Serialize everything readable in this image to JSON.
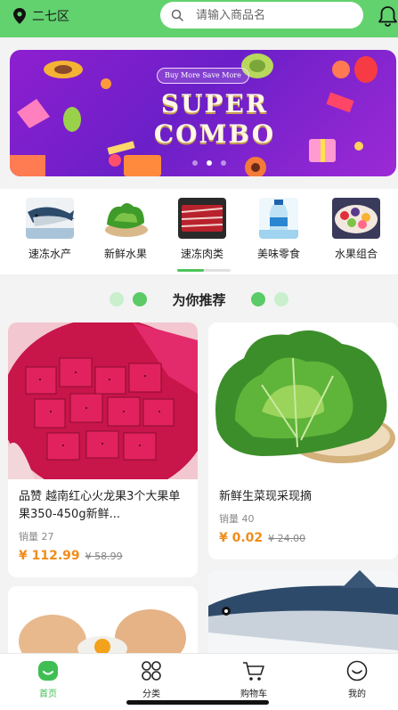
{
  "header": {
    "location": "二七区",
    "search_placeholder": "请输入商品名"
  },
  "banner": {
    "tag": "Buy More Save More",
    "title_line1": "SUPER",
    "title_line2": "COMBO",
    "page_count": 3,
    "active_page": 2
  },
  "categories": [
    {
      "label": "速冻水产",
      "icon": "fish-image"
    },
    {
      "label": "新鲜水果",
      "icon": "lettuce-image"
    },
    {
      "label": "速冻肉类",
      "icon": "meat-image"
    },
    {
      "label": "美味零食",
      "icon": "water-bottle-image"
    },
    {
      "label": "水果组合",
      "icon": "fruit-combo-image"
    }
  ],
  "section": {
    "title": "为你推荐"
  },
  "products": [
    {
      "title": "品赞 越南红心火龙果3个大果单果350-450g新鲜...",
      "sales": "销量 27",
      "price": "¥ 112.99",
      "old_price": "¥ 58.99",
      "image": "dragon-fruit-image"
    },
    {
      "title": "新鲜生菜现采现摘",
      "sales": "销量 40",
      "price": "¥ 0.02",
      "old_price": "¥ 24.00",
      "image": "lettuce-image"
    },
    {
      "image": "eggs-image"
    },
    {
      "image": "fish-image"
    }
  ],
  "tabbar": {
    "items": [
      {
        "label": "首页",
        "icon": "home-icon",
        "active": true
      },
      {
        "label": "分类",
        "icon": "category-icon",
        "active": false
      },
      {
        "label": "购物车",
        "icon": "cart-icon",
        "active": false
      },
      {
        "label": "我的",
        "icon": "profile-icon",
        "active": false
      }
    ]
  },
  "colors": {
    "accent": "#62d26f",
    "price": "#f08c1b",
    "active_tab": "#3fbf53"
  }
}
